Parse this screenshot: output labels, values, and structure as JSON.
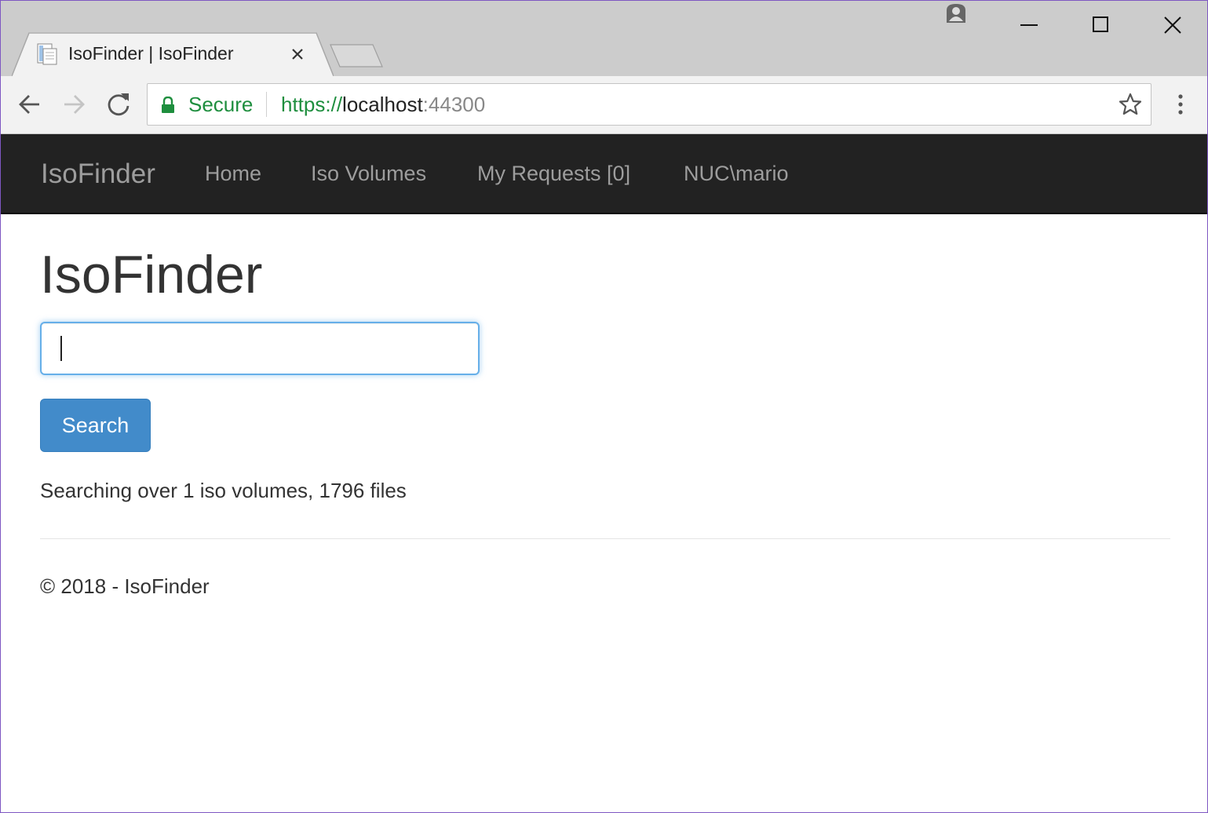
{
  "browser": {
    "tab_title": "IsoFinder | IsoFinder",
    "secure_label": "Secure",
    "url_scheme": "https://",
    "url_host": "localhost",
    "url_port": ":44300"
  },
  "navbar": {
    "brand": "IsoFinder",
    "links": [
      {
        "label": "Home"
      },
      {
        "label": "Iso Volumes"
      },
      {
        "label": "My Requests [0]"
      },
      {
        "label": "NUC\\mario"
      }
    ]
  },
  "main": {
    "title": "IsoFinder",
    "search_value": "",
    "search_button": "Search",
    "stats_text": "Searching over 1 iso volumes, 1796 files"
  },
  "footer": {
    "text": "© 2018 - IsoFinder"
  },
  "colors": {
    "navbar_bg": "#222222",
    "nav_text": "#9d9d9d",
    "primary_button": "#428bca",
    "secure_green": "#1e8e3e",
    "focus_border": "#66afe9"
  }
}
